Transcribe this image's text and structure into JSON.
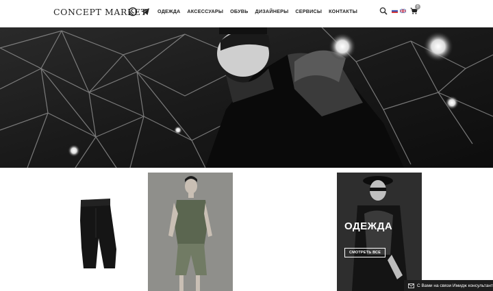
{
  "header": {
    "logo": "CONCEPT MARKET",
    "nav": [
      "ОДЕЖДА",
      "АКСЕССУАРЫ",
      "ОБУВЬ",
      "ДИЗАЙНЕРЫ",
      "СЕРВИСЫ",
      "КОНТАКТЫ"
    ],
    "cart_count": "0",
    "icons": {
      "whatsapp": "whatsapp-icon",
      "telegram": "telegram-icon",
      "search": "search-icon",
      "cart": "cart-icon"
    },
    "languages": [
      "ru-flag-icon",
      "en-flag-icon"
    ]
  },
  "hero": {
    "slides": 2,
    "active_slide": 2
  },
  "category": {
    "title": "ОДЕЖДА",
    "button": "СМОТРЕТЬ ВСЕ"
  },
  "chat": {
    "text": "С Вами на связи Имидж консультант"
  }
}
